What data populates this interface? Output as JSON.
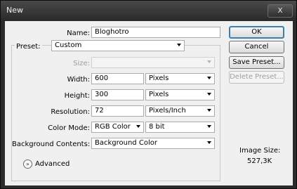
{
  "window": {
    "title": "New",
    "close_label": "X"
  },
  "form": {
    "name_label": "Name:",
    "name_value": "Bloghotro",
    "preset_label": "Preset:",
    "preset_value": "Custom",
    "size_label": "Size:",
    "size_value": "",
    "width_label": "Width:",
    "width_value": "600",
    "width_unit": "Pixels",
    "height_label": "Height:",
    "height_value": "300",
    "height_unit": "Pixels",
    "resolution_label": "Resolution:",
    "resolution_value": "72",
    "resolution_unit": "Pixels/Inch",
    "color_mode_label": "Color Mode:",
    "color_mode_value": "RGB Color",
    "bit_depth_value": "8 bit",
    "background_label": "Background Contents:",
    "background_value": "Background Color",
    "advanced_label": "Advanced",
    "advanced_icon": "double-chevron-down-icon"
  },
  "buttons": {
    "ok": "OK",
    "cancel": "Cancel",
    "save_preset": "Save Preset...",
    "delete_preset": "Delete Preset..."
  },
  "image_size": {
    "label": "Image Size:",
    "value": "527,3K"
  }
}
